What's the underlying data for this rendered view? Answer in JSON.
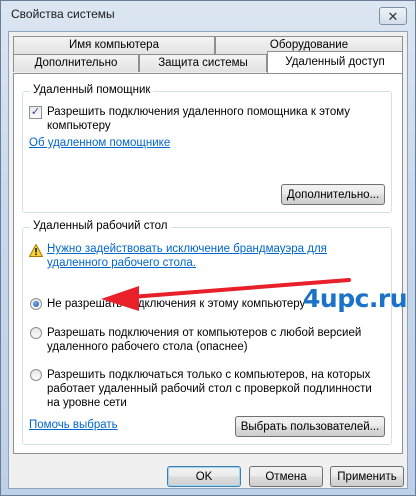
{
  "window": {
    "title": "Свойства системы",
    "close_glyph": "✕"
  },
  "tabs": {
    "row_back": [
      "Имя компьютера",
      "Оборудование"
    ],
    "row_front": [
      "Дополнительно",
      "Защита системы",
      "Удаленный доступ"
    ],
    "active": "Удаленный доступ"
  },
  "remote_assistance": {
    "group_title": "Удаленный помощник",
    "allow_checkbox_label": "Разрешить подключения удаленного помощника к этому компьютеру",
    "allow_checked": true,
    "about_link": "Об удаленном помощнике",
    "advanced_button": "Дополнительно..."
  },
  "remote_desktop": {
    "group_title": "Удаленный рабочий стол",
    "firewall_warning_link": "Нужно задействовать исключение брандмауэра для удаленного рабочего стола.",
    "options": [
      {
        "label": "Не разрешать подключения к этому компьютеру",
        "checked": true
      },
      {
        "label": "Разрешать подключения от компьютеров с любой версией удаленного рабочего стола (опаснее)",
        "checked": false
      },
      {
        "label": "Разрешить подключаться только с компьютеров, на которых работает удаленный рабочий стол с проверкой подлинности на уровне сети",
        "checked": false
      }
    ],
    "help_link": "Помочь выбрать",
    "select_users_button": "Выбрать пользователей..."
  },
  "footer": {
    "ok": "OK",
    "cancel": "Отмена",
    "apply": "Применить"
  },
  "watermark": "4upc.ru",
  "colors": {
    "link": "#0066cc",
    "annotation_arrow": "#e8202a",
    "watermark": "#1a73c7"
  }
}
